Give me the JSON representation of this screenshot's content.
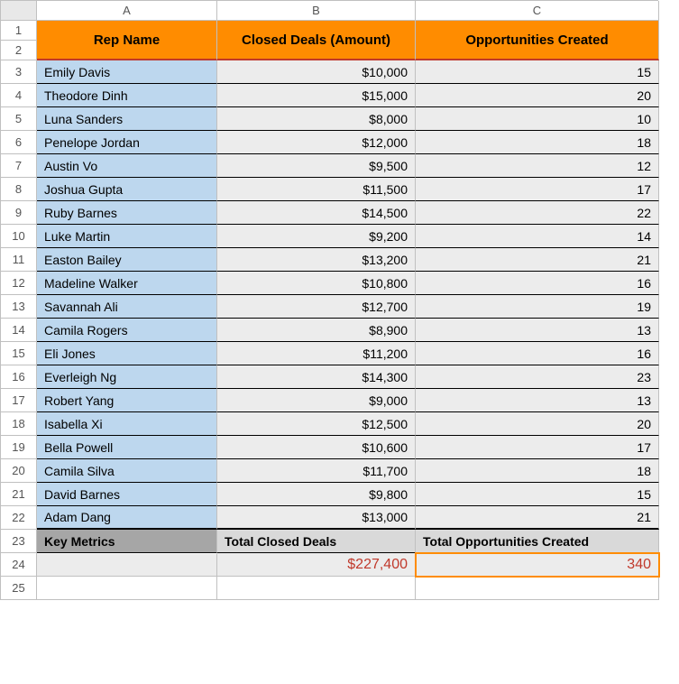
{
  "columns": [
    "A",
    "B",
    "C"
  ],
  "headers": {
    "a": "Rep Name",
    "b": "Closed Deals (Amount)",
    "c": "Opportunities Created"
  },
  "rows": [
    {
      "name": "Emily Davis",
      "amount": "$10,000",
      "opps": "15"
    },
    {
      "name": "Theodore Dinh",
      "amount": "$15,000",
      "opps": "20"
    },
    {
      "name": "Luna Sanders",
      "amount": "$8,000",
      "opps": "10"
    },
    {
      "name": "Penelope Jordan",
      "amount": "$12,000",
      "opps": "18"
    },
    {
      "name": "Austin Vo",
      "amount": "$9,500",
      "opps": "12"
    },
    {
      "name": "Joshua Gupta",
      "amount": "$11,500",
      "opps": "17"
    },
    {
      "name": "Ruby Barnes",
      "amount": "$14,500",
      "opps": "22"
    },
    {
      "name": "Luke Martin",
      "amount": "$9,200",
      "opps": "14"
    },
    {
      "name": "Easton Bailey",
      "amount": "$13,200",
      "opps": "21"
    },
    {
      "name": "Madeline Walker",
      "amount": "$10,800",
      "opps": "16"
    },
    {
      "name": "Savannah Ali",
      "amount": "$12,700",
      "opps": "19"
    },
    {
      "name": "Camila Rogers",
      "amount": "$8,900",
      "opps": "13"
    },
    {
      "name": "Eli Jones",
      "amount": "$11,200",
      "opps": "16"
    },
    {
      "name": "Everleigh Ng",
      "amount": "$14,300",
      "opps": "23"
    },
    {
      "name": "Robert Yang",
      "amount": "$9,000",
      "opps": "13"
    },
    {
      "name": "Isabella Xi",
      "amount": "$12,500",
      "opps": "20"
    },
    {
      "name": "Bella Powell",
      "amount": "$10,600",
      "opps": "17"
    },
    {
      "name": "Camila Silva",
      "amount": "$11,700",
      "opps": "18"
    },
    {
      "name": "David Barnes",
      "amount": "$9,800",
      "opps": "15"
    },
    {
      "name": "Adam Dang",
      "amount": "$13,000",
      "opps": "21"
    }
  ],
  "metrics": {
    "label": "Key Metrics",
    "col_b": "Total Closed Deals",
    "col_c": "Total Opportunities Created",
    "total_amount": "$227,400",
    "total_opps": "340"
  }
}
